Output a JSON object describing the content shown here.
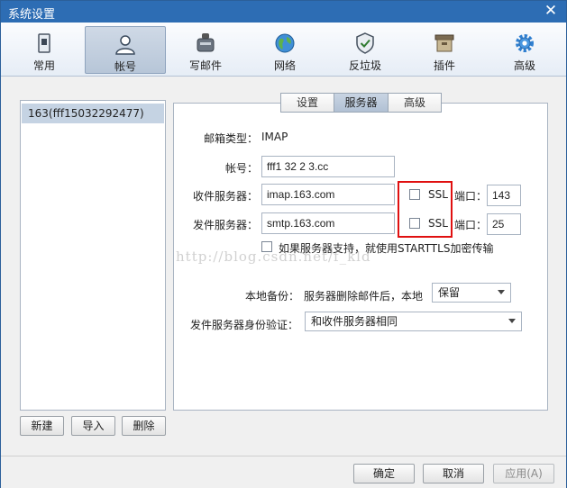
{
  "window": {
    "title": "系统设置",
    "close_glyph": "✕"
  },
  "toolbar": {
    "items": [
      {
        "label": "常用",
        "icon": "general-icon"
      },
      {
        "label": "帐号",
        "icon": "account-icon"
      },
      {
        "label": "写邮件",
        "icon": "compose-icon"
      },
      {
        "label": "网络",
        "icon": "network-icon"
      },
      {
        "label": "反垃圾",
        "icon": "antispam-icon"
      },
      {
        "label": "插件",
        "icon": "plugin-icon"
      },
      {
        "label": "高级",
        "icon": "advanced-icon"
      }
    ],
    "active_index": 1
  },
  "accounts": {
    "items": [
      {
        "label": "163(fff15032292477)"
      }
    ],
    "new_label": "新建",
    "import_label": "导入",
    "delete_label": "删除"
  },
  "tabs": {
    "items": [
      {
        "label": "设置"
      },
      {
        "label": "服务器"
      },
      {
        "label": "高级"
      }
    ],
    "active_index": 1
  },
  "server": {
    "mailbox_type_label": "邮箱类型：",
    "mailbox_type_value": "IMAP",
    "account_label": "帐号：",
    "account_value": "fff1  32  2  3.cc",
    "incoming_label": "收件服务器：",
    "incoming_value": "imap.163.com",
    "incoming_ssl_label": "SSL",
    "incoming_ssl_checked": false,
    "incoming_port_label": "端口：",
    "incoming_port_value": "143",
    "outgoing_label": "发件服务器：",
    "outgoing_value": "smtp.163.com",
    "outgoing_ssl_label": "SSL",
    "outgoing_ssl_checked": false,
    "outgoing_port_label": "端口：",
    "outgoing_port_value": "25",
    "starttls_label": "如果服务器支持，就使用STARTTLS加密传输",
    "starttls_checked": false,
    "backup_label": "本地备份：",
    "backup_desc": "服务器删除邮件后，本地",
    "backup_value": "保留",
    "auth_label": "发件服务器身份验证：",
    "auth_value": "和收件服务器相同"
  },
  "watermark": "http://blog.csdn.net/f_kld",
  "footer": {
    "ok_label": "确定",
    "cancel_label": "取消",
    "apply_label": "应用(A)"
  },
  "colors": {
    "titlebar": "#2d6db4",
    "highlight_box": "#e01010",
    "selection": "#c5d3e3"
  }
}
